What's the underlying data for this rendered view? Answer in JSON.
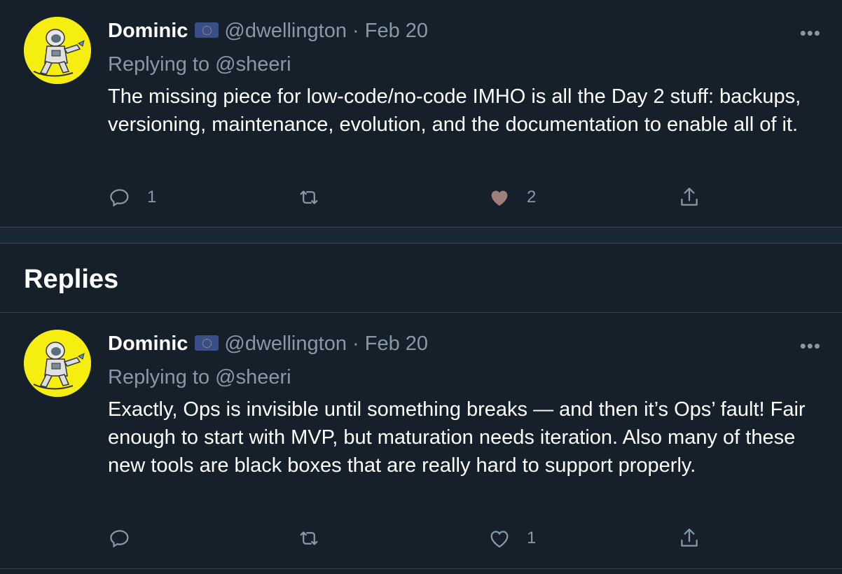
{
  "tweets": [
    {
      "author_name": "Dominic",
      "handle": "@dwellington",
      "separator": "·",
      "date": "Feb 20",
      "replying_to": "Replying to @sheeri",
      "text": "The missing piece for low-code/no-code IMHO is all the Day 2 stuff: backups, versioning, maintenance, evolution, and the documentation to enable all of it.",
      "reply_count": "1",
      "retweet_count": "",
      "like_count": "2",
      "liked": true,
      "more_icon": "•••"
    },
    {
      "author_name": "Dominic",
      "handle": "@dwellington",
      "separator": "·",
      "date": "Feb 20",
      "replying_to": "Replying to @sheeri",
      "text": "Exactly, Ops is invisible until something breaks — and then it’s Ops’ fault! Fair enough to start with MVP, but maturation needs iteration. Also many of these new tools are black boxes that are really hard to support properly.",
      "reply_count": "",
      "retweet_count": "",
      "like_count": "1",
      "liked": false,
      "more_icon": "•••"
    }
  ],
  "replies_section": {
    "title": "Replies"
  },
  "colors": {
    "background": "#15202b",
    "secondary_text": "#8899a6",
    "avatar_bg": "#f5ee10",
    "liked_heart": "#9e7f7a"
  },
  "icons": [
    "reply-icon",
    "retweet-icon",
    "like-icon",
    "share-icon",
    "more-icon",
    "flag-icon"
  ]
}
